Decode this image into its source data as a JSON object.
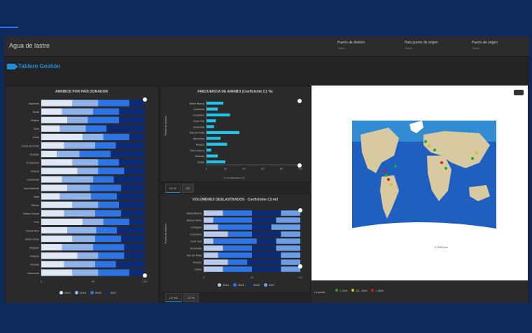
{
  "app": {
    "title": "Agua de lastre",
    "fields": [
      {
        "label": "Puerto de destino",
        "value": "Todos"
      },
      {
        "label": "País puerto de origen",
        "value": "Todos"
      },
      {
        "label": "Puerto de origen",
        "value": "Todos"
      }
    ],
    "dashboard_title": "Tablero Gestión"
  },
  "panels": {
    "left": {
      "title": "ARRIBOS POR PAÍS DONADOR"
    },
    "mid_top": {
      "title": "FRECUENCIA DE ARRIBO (Coeficiente C1 %)",
      "ylabel": "Puerto de destino",
      "xlabel": "% Coeficiente C1"
    },
    "mid_bottom": {
      "title": "VOLÚMENES DESLASTRADOS - Coeficiente C2 m3",
      "ylabel": "Puerto de destino"
    },
    "tabs_top": [
      "C1 %",
      "C2"
    ],
    "tabs_bottom": [
      "C2 m3",
      "C2 %"
    ]
  },
  "map": {
    "legend_title": "Leyenda",
    "legend_items": [
      {
        "label": "< 10%",
        "color": "#22a82a"
      },
      {
        "label": "10 - 30%",
        "color": "#c8c81e"
      },
      {
        "label": "> 30%",
        "color": "#d02020"
      }
    ],
    "scale_label": "0 2500 km"
  },
  "chart_data": [
    {
      "type": "bar",
      "title": "ARRIBOS POR PAÍS DONADOR",
      "orientation": "horizontal",
      "stacked": true,
      "categories": [
        "Argentina",
        "Brasil",
        "Bélgica",
        "Chile",
        "China",
        "Corea del Norte",
        "Ecuador",
        "El Salvador",
        "Francia",
        "Guatemala",
        "Islas Marshall",
        "Italia",
        "México",
        "Nueva Guinea",
        "Perú",
        "Puerto Rico",
        "Reino Unido",
        "Singapur",
        "Uruguay",
        "Vanuatu",
        "Venezuela"
      ],
      "series": [
        {
          "name": "2014",
          "color": "#dfe8f7",
          "values": [
            30,
            20,
            25,
            18,
            40,
            22,
            15,
            30,
            35,
            20,
            25,
            18,
            30,
            22,
            40,
            25,
            30,
            20,
            35,
            22,
            30
          ]
        },
        {
          "name": "2015",
          "color": "#8fb2ea",
          "values": [
            25,
            30,
            20,
            25,
            20,
            30,
            22,
            25,
            20,
            30,
            22,
            30,
            25,
            30,
            20,
            28,
            22,
            30,
            20,
            30,
            25
          ]
        },
        {
          "name": "2016",
          "color": "#2d74e6",
          "values": [
            30,
            25,
            30,
            20,
            25,
            20,
            30,
            20,
            25,
            20,
            30,
            25,
            20,
            25,
            25,
            20,
            25,
            30,
            25,
            20,
            30
          ]
        },
        {
          "name": "2017",
          "color": "#0b2a78",
          "values": [
            15,
            25,
            25,
            37,
            15,
            28,
            33,
            25,
            20,
            30,
            23,
            27,
            25,
            23,
            15,
            27,
            23,
            20,
            20,
            28,
            15
          ]
        }
      ],
      "xlim": [
        0,
        100
      ],
      "xticks": [
        0,
        50,
        100
      ]
    },
    {
      "type": "bar",
      "title": "FRECUENCIA DE ARRIBO (Coeficiente C1 %)",
      "orientation": "horizontal",
      "categories": [
        "Bahía Blanca",
        "Campana",
        "Comodoro",
        "Dock Sud",
        "Ensenada",
        "Mar del Plata",
        "Necochea",
        "Rosario",
        "San Lorenzo",
        "Ushuaia",
        "Zárate"
      ],
      "values": [
        18,
        12,
        25,
        10,
        8,
        35,
        15,
        22,
        5,
        12,
        20
      ],
      "color": "#22c4e8",
      "xlim": [
        0,
        100
      ],
      "xticks": [
        0,
        20,
        40,
        60,
        80,
        100
      ]
    },
    {
      "type": "bar",
      "title": "VOLÚMENES DESLASTRADOS - Coeficiente C2 m3",
      "orientation": "horizontal",
      "stacked": true,
      "categories": [
        "Bahía Blanca",
        "Buenos Aires",
        "Campana",
        "Comodoro",
        "Dock Sud",
        "Ensenada",
        "Mar del Plata",
        "Rosario",
        "Zárate"
      ],
      "series": [
        {
          "name": "2014",
          "color": "#b8cbef",
          "values": [
            20,
            10,
            15,
            25,
            10,
            20,
            15,
            25,
            20
          ]
        },
        {
          "name": "2015",
          "color": "#2d74e6",
          "values": [
            30,
            40,
            35,
            25,
            45,
            30,
            35,
            20,
            30
          ]
        },
        {
          "name": "2016",
          "color": "#0b2a78",
          "values": [
            30,
            25,
            20,
            30,
            20,
            25,
            30,
            35,
            30
          ]
        },
        {
          "name": "2017",
          "color": "#6e9de8",
          "values": [
            20,
            25,
            30,
            20,
            25,
            25,
            20,
            20,
            20
          ]
        }
      ],
      "xlim": [
        0,
        100
      ],
      "xticks": [
        0,
        50,
        100
      ]
    }
  ]
}
